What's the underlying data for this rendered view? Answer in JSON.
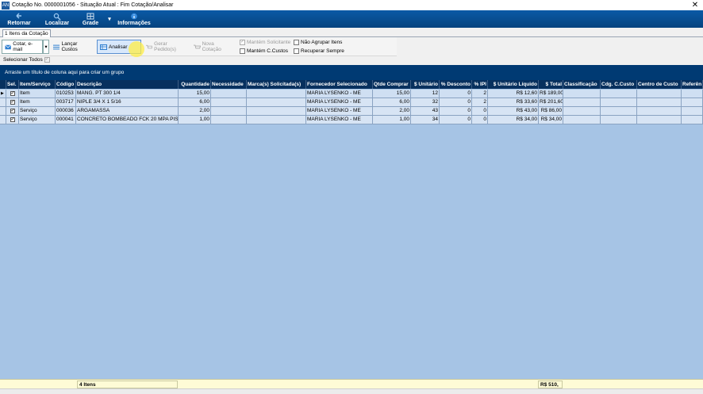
{
  "window": {
    "title": "Cotação No. 0000001056 - Situação Atual : Fim Cotação/Analisar",
    "app_icon": "AN"
  },
  "ribbon": [
    {
      "label": "Retornar",
      "icon": "back-arrow-icon"
    },
    {
      "label": "Localizar",
      "icon": "search-icon"
    },
    {
      "label": "Grade",
      "icon": "grid-icon",
      "caret": "▾"
    },
    {
      "label": "Informações",
      "icon": "info-icon"
    }
  ],
  "tab": {
    "label": "1 Itens da Cotação"
  },
  "toolbar": {
    "cotar_label": "Cotar, e-mail",
    "lancar_label": "Lançar Custos",
    "analisar_label": "Analisar",
    "gerar_label": "Gerar Pedido(s)",
    "nova_label": "Nova Cotação",
    "check_mantem_solicitante": {
      "label": "Mantém Solicitante",
      "checked": true
    },
    "check_mantem_ccustos": {
      "label": "Mantém C.Custos",
      "checked": false
    },
    "check_nao_agrupar": {
      "label": "Não Agrupar Itens",
      "checked": false
    },
    "check_recuperar": {
      "label": "Recuperar Sempre",
      "checked": false
    }
  },
  "select_all_label": "Selecionar Todos",
  "group_hint": "Arraste um título de coluna aqui para criar um grupo",
  "columns": [
    "Sel.",
    "Item/Serviço",
    "Código",
    "Descrição",
    "Quantidade",
    "Necessidade",
    "Marca(s) Solicitada(s)",
    "Fornecedor Selecionado",
    "Qtde Comprar",
    "$ Unitário",
    "% Desconto",
    "% IPI",
    "$ Unitário Líquido",
    "$ Total",
    "Classificação",
    "Cdg. C.Custo",
    "Centro de Custo",
    "Referên"
  ],
  "rows": [
    {
      "tipo": "Item",
      "codigo": "010253",
      "descricao": "MANG. PT 300 1/4",
      "quantidade": "15,00",
      "fornecedor": "MARIA LYSENKO - ME",
      "qtde": "15,00",
      "unitario": "12",
      "desconto": "0",
      "ipi": "2",
      "liquido": "R$ 12,60",
      "total": "R$ 189,00"
    },
    {
      "tipo": "Item",
      "codigo": "003717",
      "descricao": "NIPLE 3/4 X 1 5/16",
      "quantidade": "6,00",
      "fornecedor": "MARIA LYSENKO - ME",
      "qtde": "6,00",
      "unitario": "32",
      "desconto": "0",
      "ipi": "2",
      "liquido": "R$ 33,60",
      "total": "R$ 201,60"
    },
    {
      "tipo": "Serviço",
      "codigo": "000036",
      "descricao": "ARGAMASSA",
      "quantidade": "2,00",
      "fornecedor": "MARIA LYSENKO - ME",
      "qtde": "2,00",
      "unitario": "43",
      "desconto": "0",
      "ipi": "0",
      "liquido": "R$ 43,00",
      "total": "R$ 86,00"
    },
    {
      "tipo": "Serviço",
      "codigo": "000041",
      "descricao": "CONCRETO BOMBEADO FCK 20 MPA PISO",
      "quantidade": "1,00",
      "fornecedor": "MARIA LYSENKO - ME",
      "qtde": "1,00",
      "unitario": "34",
      "desconto": "0",
      "ipi": "0",
      "liquido": "R$ 34,00",
      "total": "R$ 34,00"
    }
  ],
  "footer": {
    "count": "4 Itens",
    "total": "R$ 510,"
  },
  "colors": {
    "ribbon": "#06437f",
    "header": "#07305e",
    "grid_bg": "#a6c4e5",
    "group_bar": "#003a73"
  }
}
